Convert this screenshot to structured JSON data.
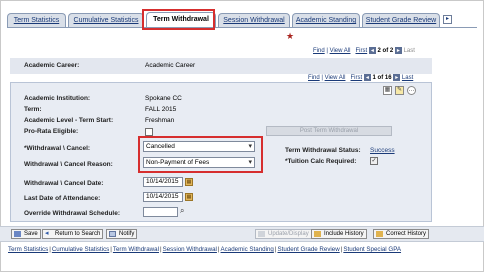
{
  "tabs": [
    {
      "label": "Term Statistics"
    },
    {
      "label": "Cumulative Statistics"
    },
    {
      "label": "Term Withdrawal"
    },
    {
      "label": "Session Withdrawal"
    },
    {
      "label": "Academic Standing"
    },
    {
      "label": "Student Grade Review"
    }
  ],
  "nav_top": {
    "find": "Find",
    "view_all": "View All",
    "first": "First",
    "position": "2 of 2",
    "last": "Last"
  },
  "career": {
    "label": "Academic Career:",
    "value": "Academic Career"
  },
  "nav_inner": {
    "find": "Find",
    "view_all": "View All",
    "first": "First",
    "position": "1 of 16",
    "last": "Last"
  },
  "fields": {
    "institution_label": "Academic Institution:",
    "institution_value": "Spokane CC",
    "term_label": "Term:",
    "term_value": "FALL 2015",
    "level_label": "Academic Level - Term Start:",
    "level_value": "Freshman",
    "prorata_label": "Pro-Rata Eligible:",
    "post_button": "Post Term Withdrawal",
    "withdrawal_cancel_label": "*Withdrawal \\ Cancel:",
    "withdrawal_cancel_value": "Cancelled",
    "reason_label": "Withdrawal \\ Cancel Reason:",
    "reason_value": "Non-Payment of Fees",
    "status_label": "Term Withdrawal Status:",
    "status_value": "Success",
    "tuition_label": "*Tuition Calc Required:",
    "date_label": "Withdrawal \\ Cancel Date:",
    "date_value": "10/14/2015",
    "attendance_label": "Last Date of Attendance:",
    "attendance_value": "10/14/2015",
    "override_label": "Override Withdrawal Schedule:",
    "override_value": ""
  },
  "buttons": {
    "save": "Save",
    "return": "Return to Search",
    "notify": "Notify",
    "update": "Update/Display",
    "include_history": "Include History",
    "correct_history": "Correct History"
  },
  "footer_links": [
    "Term Statistics",
    "Cumulative Statistics",
    "Term Withdrawal",
    "Session Withdrawal",
    "Academic Standing",
    "Student Grade Review",
    "Student Special GPA"
  ]
}
